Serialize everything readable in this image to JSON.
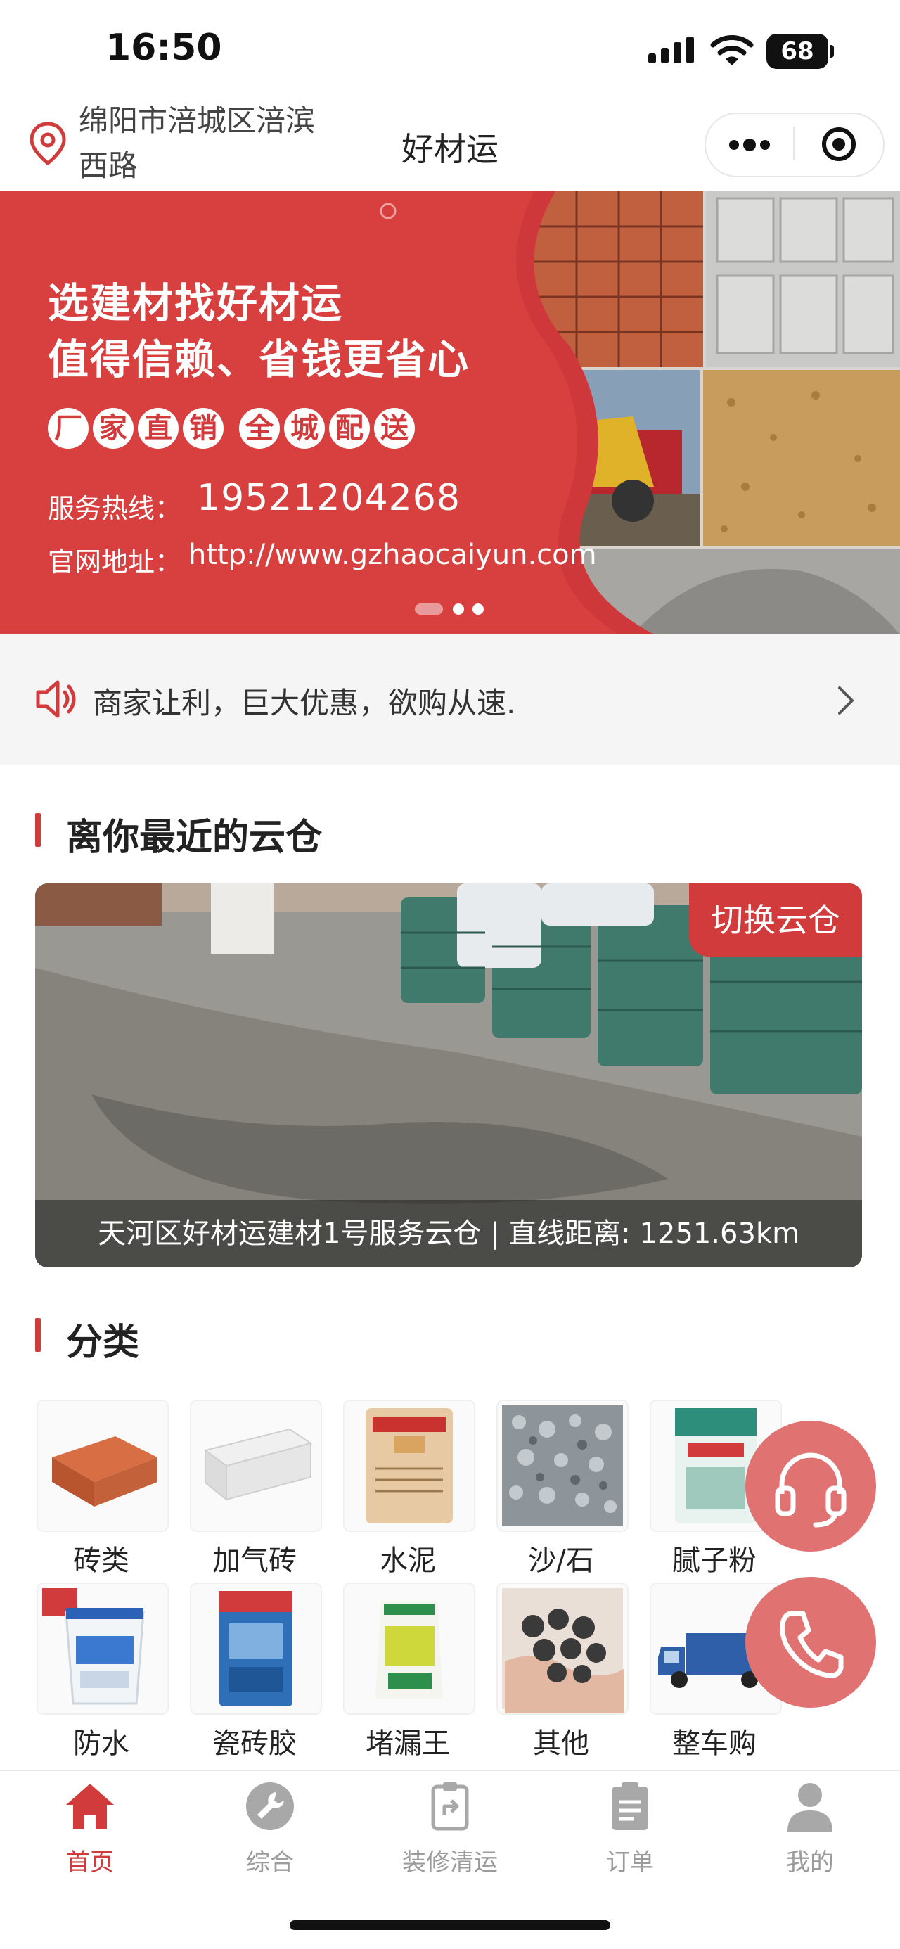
{
  "status_bar": {
    "time": "16:50",
    "battery": "68"
  },
  "header": {
    "location_line1": "绵阳市涪城区涪滨",
    "location_line2": "西路",
    "title": "好材运"
  },
  "banner": {
    "line1": "选建材找好材运",
    "line2": "值得信赖、省钱更省心",
    "tags": [
      "厂",
      "家",
      "直",
      "销",
      "全",
      "城",
      "配",
      "送"
    ],
    "hotline_label": "服务热线：",
    "hotline": "19521204268",
    "site_label": "官网地址：",
    "site": "http://www.gzhaocaiyun.com",
    "active_slide": 1,
    "slide_count": 3
  },
  "notice": {
    "text": "商家让利，巨大优惠，欲购从速."
  },
  "warehouse": {
    "section_title": "离你最近的云仓",
    "switch_label": "切换云仓",
    "caption": "天河区好材运建材1号服务云仓 | 直线距离: 1251.63km"
  },
  "categories": {
    "section_title": "分类",
    "items": [
      {
        "label": "砖类"
      },
      {
        "label": "加气砖"
      },
      {
        "label": "水泥"
      },
      {
        "label": "沙/石"
      },
      {
        "label": "腻子粉"
      },
      {
        "label": "防水"
      },
      {
        "label": "瓷砖胶"
      },
      {
        "label": "堵漏王"
      },
      {
        "label": "其他"
      },
      {
        "label": "整车购"
      }
    ]
  },
  "tabs": [
    {
      "label": "首页",
      "icon": "home-icon",
      "active": true
    },
    {
      "label": "综合",
      "icon": "wrench-icon",
      "active": false
    },
    {
      "label": "装修清运",
      "icon": "clipboard-icon",
      "active": false
    },
    {
      "label": "订单",
      "icon": "order-icon",
      "active": false
    },
    {
      "label": "我的",
      "icon": "user-icon",
      "active": false
    }
  ],
  "colors": {
    "accent": "#d23b3b",
    "fab": "#e07272",
    "inactive": "#9b9b9b"
  }
}
